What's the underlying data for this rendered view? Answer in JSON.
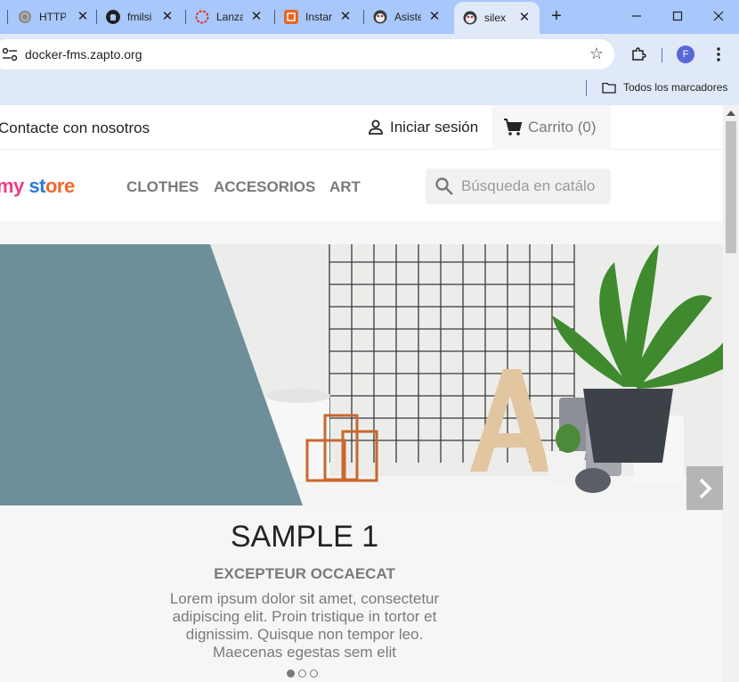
{
  "browser": {
    "tabs": [
      {
        "title": "HTTP",
        "favicon": "globe-icon",
        "color": "#8a8a8a"
      },
      {
        "title": "fmilsi",
        "favicon": "github-icon",
        "color": "#1f1f1f"
      },
      {
        "title": "Lanza",
        "favicon": "ubuntu-ring-icon",
        "color": "#e0352b"
      },
      {
        "title": "Instar",
        "favicon": "instance-icon",
        "color": "#e8641f"
      },
      {
        "title": "Asiste",
        "favicon": "prestashop-icon",
        "color": "#b02a3a"
      },
      {
        "title": "silex",
        "favicon": "prestashop-icon",
        "color": "#b02a3a"
      }
    ],
    "url": "docker-fms.zapto.org",
    "profile_initial": "F",
    "bookmarks_folder": "Todos los marcadores"
  },
  "store": {
    "contact": "Contacte con nosotros",
    "signin": "Iniciar sesión",
    "cart": "Carrito (0)",
    "logo": {
      "part1": "my",
      "part2": " st",
      "part3": "ore"
    },
    "menu": [
      "CLOTHES",
      "ACCESORIOS",
      "ART"
    ],
    "search_placeholder": "Búsqueda en catálo",
    "slide": {
      "title": "SAMPLE 1",
      "subtitle": "EXCEPTEUR OCCAECAT",
      "body": "Lorem ipsum dolor sit amet, consectetur adipiscing elit. Proin tristique in tortor et dignissim. Quisque non tempor leo. Maecenas egestas sem elit",
      "dots": 3,
      "active_dot": 0
    }
  },
  "colors": {
    "accent_slate": "#6d8f9a",
    "tab_strip": "#a8c7fa",
    "chrome_bg": "#dfe9f8"
  }
}
